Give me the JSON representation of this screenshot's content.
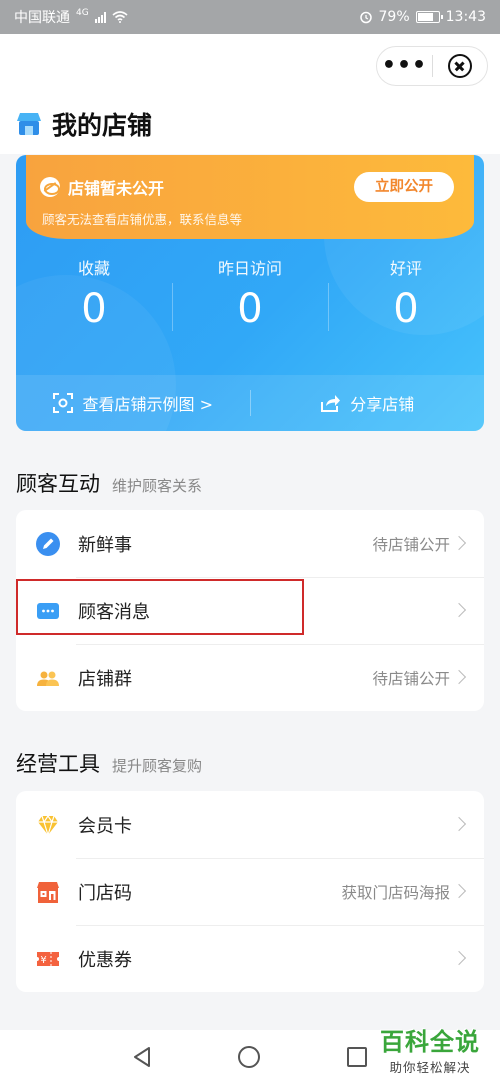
{
  "status_bar": {
    "carrier": "中国联通",
    "network": "4G",
    "battery": "79%",
    "time": "13:43"
  },
  "header": {
    "more_icon": "more-dots-icon",
    "close_icon": "close-circle-icon",
    "title": "我的店铺"
  },
  "store_card": {
    "warning_title": "店铺暂未公开",
    "warning_desc": "顾客无法查看店铺优惠，联系信息等",
    "open_button": "立即公开",
    "stats": [
      {
        "label": "收藏",
        "value": "0"
      },
      {
        "label": "昨日访问",
        "value": "0"
      },
      {
        "label": "好评",
        "value": "0"
      }
    ],
    "footer": {
      "example": "查看店铺示例图 >",
      "share": "分享店铺"
    }
  },
  "customer_section": {
    "title": "顾客互动",
    "subtitle": "维护顾客关系",
    "items": [
      {
        "label": "新鲜事",
        "status": "待店铺公开",
        "icon": "pencil-icon"
      },
      {
        "label": "顾客消息",
        "status": "",
        "icon": "message-icon"
      },
      {
        "label": "店铺群",
        "status": "待店铺公开",
        "icon": "group-icon"
      }
    ]
  },
  "tools_section": {
    "title": "经营工具",
    "subtitle": "提升顾客复购",
    "items": [
      {
        "label": "会员卡",
        "status": "",
        "icon": "diamond-icon"
      },
      {
        "label": "门店码",
        "status": "获取门店码海报",
        "icon": "store-code-icon"
      },
      {
        "label": "优惠券",
        "status": "",
        "icon": "coupon-icon"
      }
    ]
  },
  "watermark": {
    "title": "百科全说",
    "subtitle": "助你轻松解决"
  },
  "colors": {
    "primary_blue": "#2e9cf3",
    "warning_orange": "#f8a33e",
    "highlight_red": "#cf2a2a",
    "watermark_green": "#3aa63b"
  }
}
